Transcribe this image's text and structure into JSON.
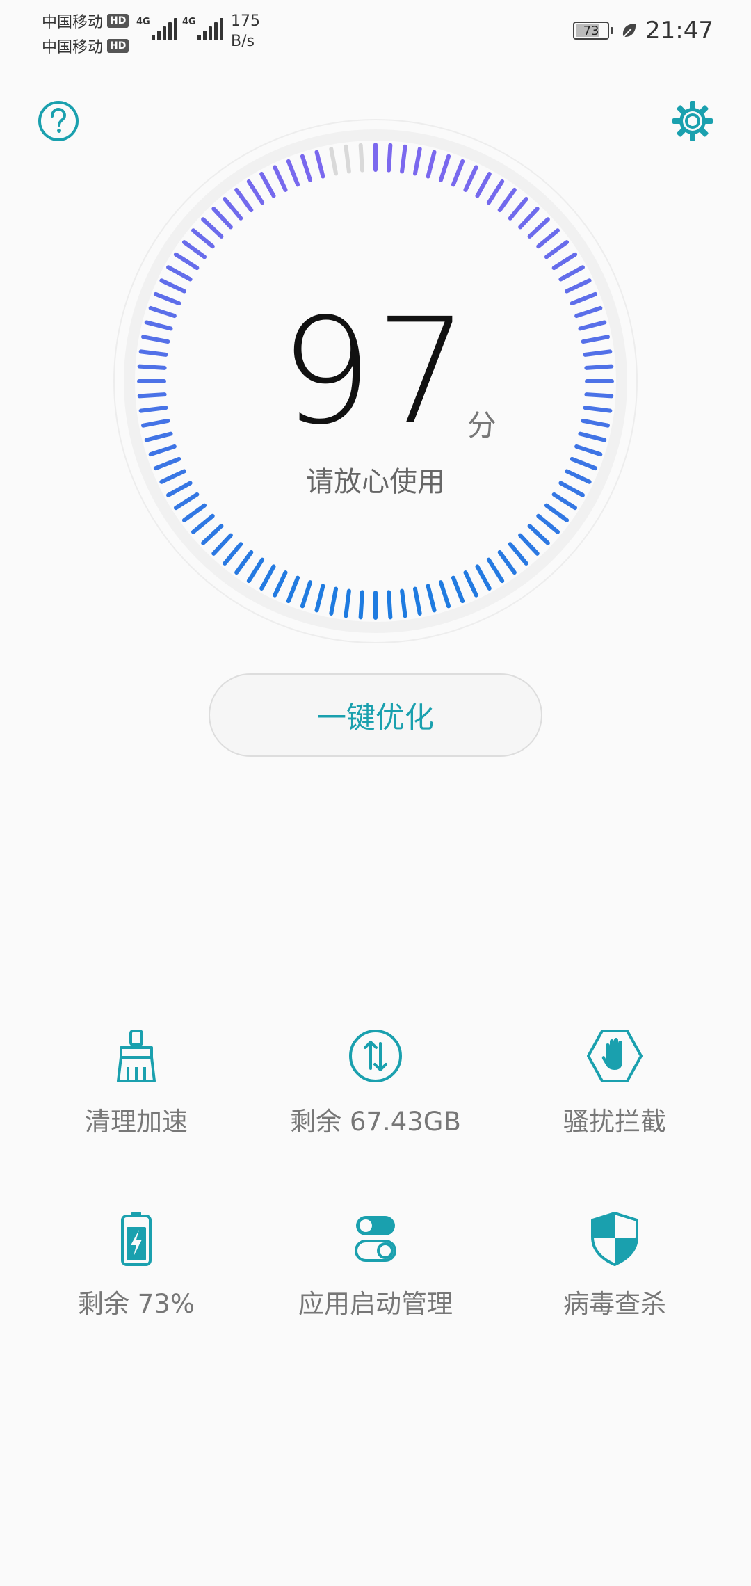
{
  "status_bar": {
    "carrier1": "中国移动",
    "carrier2": "中国移动",
    "hd_badge": "HD",
    "network1": "4G",
    "network2": "4G",
    "speed_value": "175",
    "speed_unit": "B/s",
    "battery_level": "73",
    "time": "21:47"
  },
  "header": {
    "help_icon": "help-circle-icon",
    "settings_icon": "gear-icon"
  },
  "score": {
    "value": "97",
    "unit": "分",
    "caption": "请放心使用"
  },
  "optimize_button": {
    "label": "一键优化"
  },
  "tools": [
    {
      "label": "清理加速",
      "icon": "broom-icon"
    },
    {
      "label": "剩余 67.43GB",
      "icon": "data-transfer-icon"
    },
    {
      "label": "骚扰拦截",
      "icon": "hand-stop-icon"
    },
    {
      "label": "剩余 73%",
      "icon": "battery-charging-icon"
    },
    {
      "label": "应用启动管理",
      "icon": "toggle-switches-icon"
    },
    {
      "label": "病毒查杀",
      "icon": "shield-icon"
    }
  ],
  "colors": {
    "accent": "#1aa0ae",
    "gauge_top": "#7b68ee",
    "gauge_bottom": "#1e7be0",
    "gauge_inactive": "#d9d9d9"
  }
}
